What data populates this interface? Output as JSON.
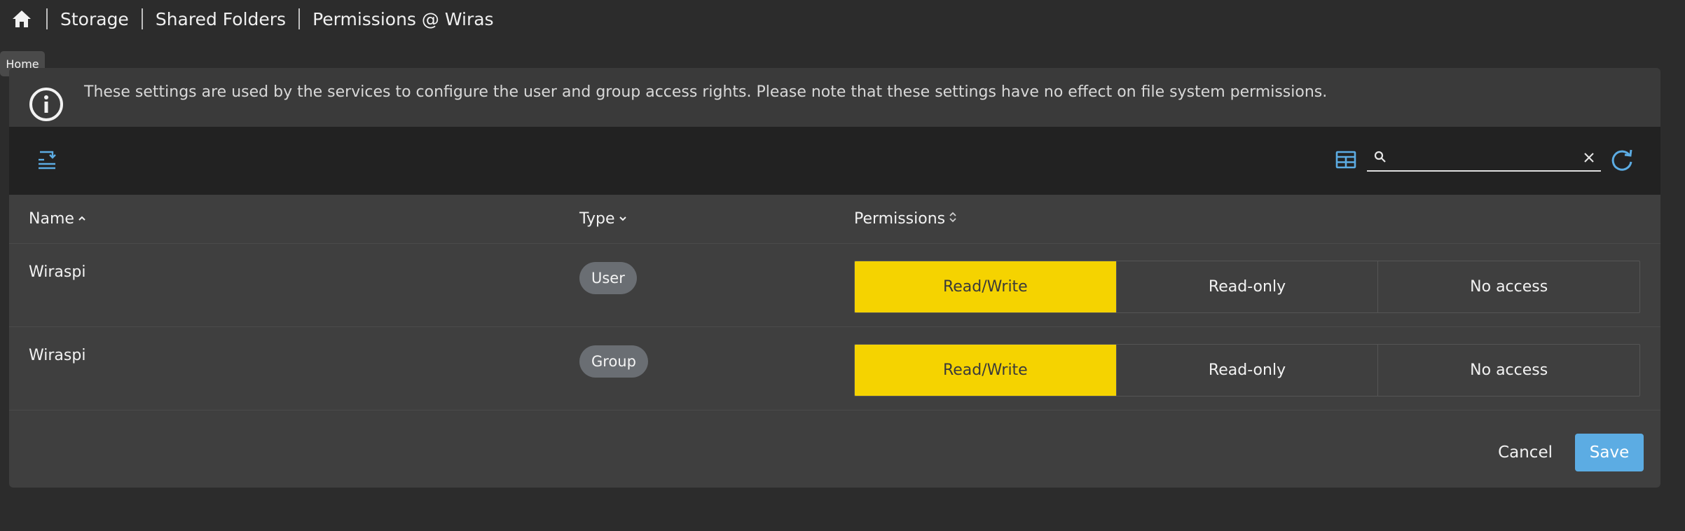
{
  "breadcrumb": {
    "home_icon": "home-icon",
    "items": [
      "Storage",
      "Shared Folders",
      "Permissions @ Wiras"
    ]
  },
  "tooltip": {
    "text": "Home"
  },
  "info": {
    "icon": "info-circle-icon",
    "text": "These settings are used by the services to configure the user and group access rights. Please note that these settings have no effect on file system permissions."
  },
  "toolbar": {
    "left_icon": "edit-list-icon",
    "columns_icon": "table-columns-icon",
    "search": {
      "value": "",
      "placeholder": ""
    },
    "refresh_icon": "refresh-icon"
  },
  "table": {
    "headers": [
      {
        "label": "Name",
        "sort": "asc"
      },
      {
        "label": "Type",
        "sort": "desc"
      },
      {
        "label": "Permissions",
        "sort": "none"
      }
    ],
    "options": [
      "Read/Write",
      "Read-only",
      "No access"
    ],
    "rows": [
      {
        "name": "Wiraspi",
        "type": "User",
        "permission": "Read/Write"
      },
      {
        "name": "Wiraspi",
        "type": "Group",
        "permission": "Read/Write"
      }
    ]
  },
  "actions": {
    "cancel": "Cancel",
    "save": "Save"
  },
  "colors": {
    "background": "#2c2c2c",
    "card": "#3f3f3f",
    "toolbar": "#222222",
    "accent": "#5cace3",
    "active_permission": "#f5d300",
    "badge": "#6a6e73"
  }
}
